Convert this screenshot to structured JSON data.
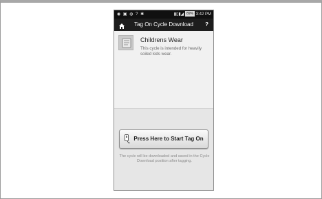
{
  "status_bar": {
    "battery": "89%",
    "time": "3:42 PM"
  },
  "header": {
    "title": "Tag On Cycle Download",
    "help": "?"
  },
  "cycle": {
    "name": "Childrens Wear",
    "description": "This cycle is intended for heavily soiled kids wear."
  },
  "start_button": {
    "label": "Press Here to Start Tag On"
  },
  "note": "The cycle will be downloaded and saved in the Cycle Download position after tagging.",
  "icons": [
    "home-icon",
    "cycle-icon",
    "tag-icon",
    "signal-icon",
    "wifi-icon",
    "battery-icon"
  ]
}
